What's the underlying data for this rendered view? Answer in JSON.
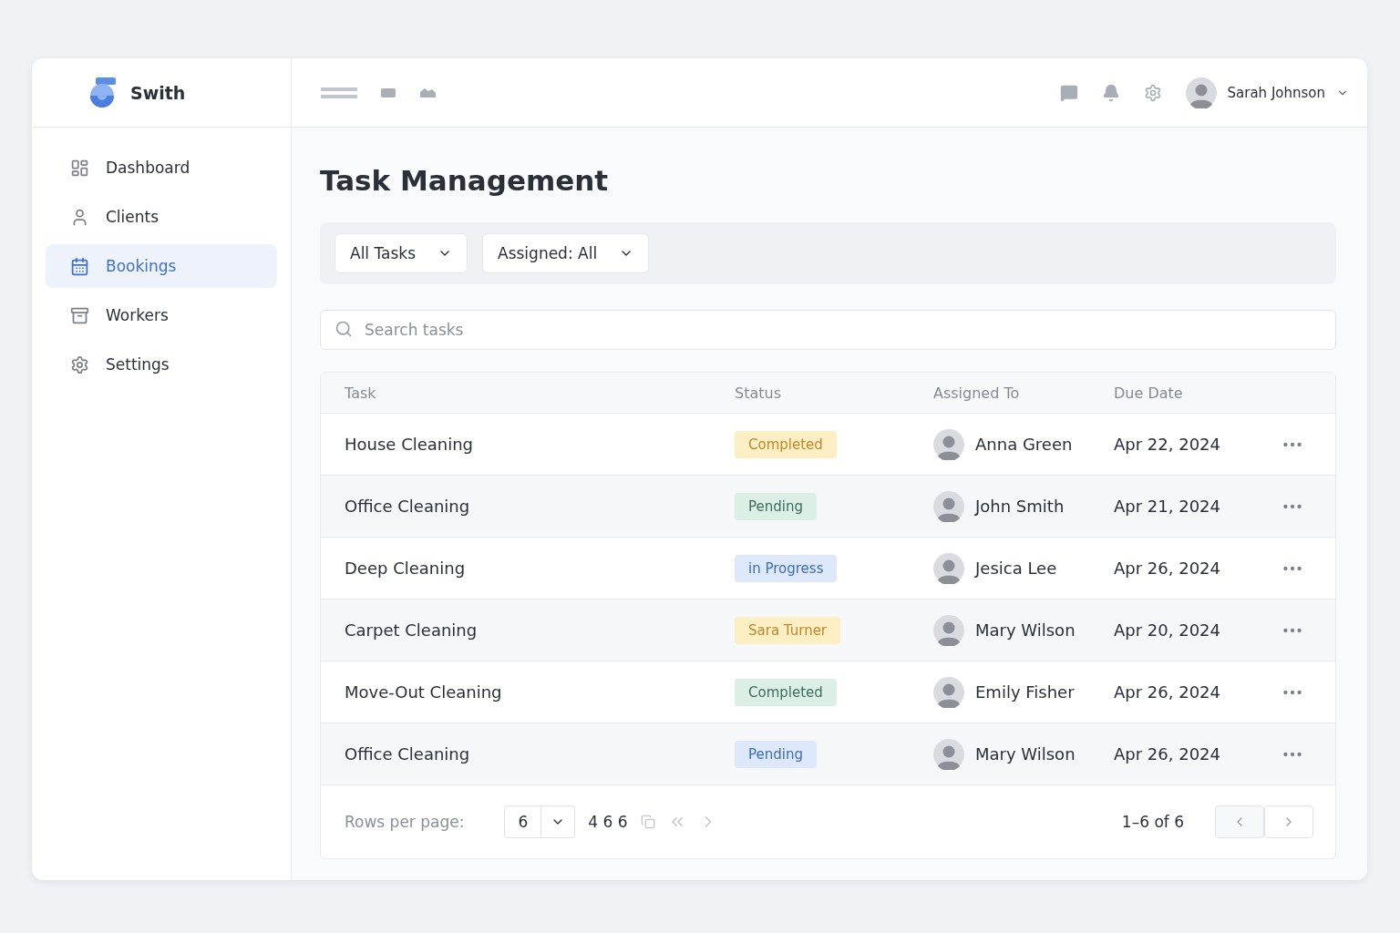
{
  "brand": {
    "name": "Swith"
  },
  "user": {
    "name": "Sarah Johnson"
  },
  "sidebar": {
    "items": [
      {
        "label": "Dashboard",
        "selected": false
      },
      {
        "label": "Clients",
        "selected": false
      },
      {
        "label": "Bookings",
        "selected": true
      },
      {
        "label": "Workers",
        "selected": false
      },
      {
        "label": "Settings",
        "selected": false
      }
    ]
  },
  "page": {
    "title": "Task Management"
  },
  "filters": [
    {
      "label": "All Tasks"
    },
    {
      "label": "Assigned: All"
    }
  ],
  "search": {
    "placeholder": "Search tasks"
  },
  "table": {
    "columns": [
      "Task",
      "Status",
      "Assigned To",
      "Due Date"
    ],
    "rows": [
      {
        "task": "House Cleaning",
        "status": "Completed",
        "color": "#fcefc4",
        "assignee": "Anna Green",
        "due": "Apr 22, 2024"
      },
      {
        "task": "Office Cleaning",
        "status": "Pending",
        "color": "#dcefe7",
        "assignee": "John Smith",
        "due": "Apr 21, 2024"
      },
      {
        "task": "Deep Cleaning",
        "status": "in Progress",
        "color": "#dde8fb",
        "assignee": "Jesica Lee",
        "due": "Apr 26, 2024"
      },
      {
        "task": "Carpet Cleaning",
        "status": "Sara Turner",
        "color": "#fcefc4",
        "assignee": "Mary Wilson",
        "due": "Apr 20, 2024"
      },
      {
        "task": "Move-Out Cleaning",
        "status": "Completed",
        "color": "#dcefe7",
        "assignee": "Emily Fisher",
        "due": "Apr 26, 2024"
      },
      {
        "task": "Office Cleaning",
        "status": "Pending",
        "color": "#dde8fb",
        "assignee": "Mary Wilson",
        "due": "Apr 26, 2024"
      }
    ]
  },
  "pagination": {
    "rows_label": "Rows per page:",
    "rows_value": "6",
    "extra": "4 6 6",
    "range": "1–6 of 6"
  }
}
